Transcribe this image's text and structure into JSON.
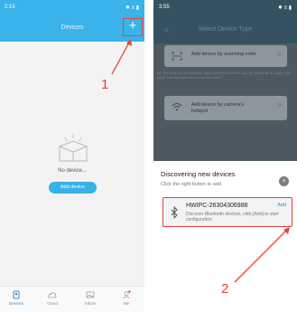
{
  "left": {
    "status_time": "2:15",
    "status_icons": "✸ ≡ ▮",
    "title": "Devices",
    "add_icon": "+",
    "empty_text": "No device...",
    "add_device_label": "Add device",
    "annotation": "1",
    "tabs": [
      {
        "label": "Devices",
        "icon": "devices-icon",
        "active": true
      },
      {
        "label": "Cloud",
        "icon": "cloud-icon",
        "active": false
      },
      {
        "label": "Album",
        "icon": "album-icon",
        "active": false
      },
      {
        "label": "Me",
        "icon": "person-icon",
        "active": false
      }
    ]
  },
  "right": {
    "status_time": "3:55",
    "status_icons": "✸ ≡ ▮",
    "back_icon": "<",
    "title": "Select Device Type",
    "option1_label": "Add device by scanning code",
    "hint_text": "No QR code on the camera. Tap in provided and the App will generate a unique QR code. Use the camera to scan the code.",
    "option2_line1": "Add device by camera's",
    "option2_line2": "hotspot",
    "chevron": ">",
    "discover_title": "Discovering new devices",
    "discover_sub": "Click the right button to add",
    "close_icon": "×",
    "device_name": "HWIPC-26304306988",
    "device_desc": "Discover Bluetooth devices, click [Add] to start configuration",
    "device_add": "Add",
    "annotation": "2"
  },
  "colors": {
    "header_blue": "#39b3e9",
    "button_blue": "#38b0e8",
    "annotation_red": "#e8413c",
    "overlay_dark": "#4d5a62"
  }
}
